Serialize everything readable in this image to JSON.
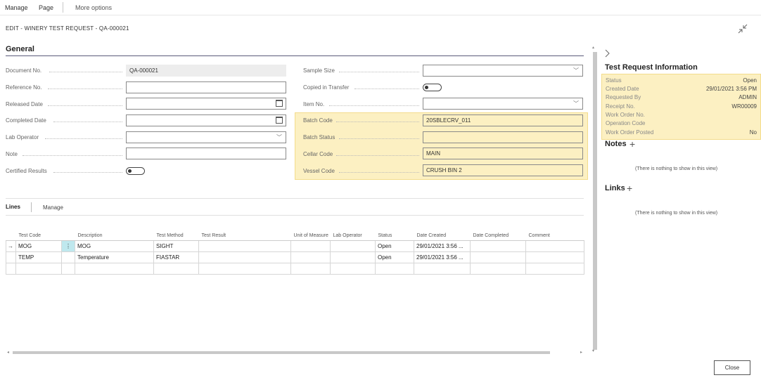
{
  "actionbar": {
    "manage": "Manage",
    "page": "Page",
    "more": "More options"
  },
  "page_title": "EDIT - WINERY TEST REQUEST - QA-000021",
  "general": {
    "heading": "General",
    "document_no_label": "Document No.",
    "document_no": "QA-000021",
    "reference_no_label": "Reference No.",
    "reference_no": "",
    "released_date_label": "Released Date",
    "released_date": "",
    "completed_date_label": "Completed Date",
    "completed_date": "",
    "lab_operator_label": "Lab Operator",
    "lab_operator": "",
    "note_label": "Note",
    "note": "",
    "certified_label": "Certified Results",
    "sample_size_label": "Sample Size",
    "sample_size": "",
    "copied_label": "Copied in Transfer",
    "item_no_label": "Item No.",
    "item_no": "",
    "batch_code_label": "Batch Code",
    "batch_code": "20SBLECRV_011",
    "batch_status_label": "Batch Status",
    "batch_status": "",
    "cellar_code_label": "Cellar Code",
    "cellar_code": "MAIN",
    "vessel_code_label": "Vessel Code",
    "vessel_code": "CRUSH BIN 2"
  },
  "lines": {
    "tab_lines": "Lines",
    "tab_manage": "Manage",
    "columns": [
      "Test Code",
      "Description",
      "Test Method",
      "Test Result",
      "Unit of Measure",
      "Lab Operator",
      "Status",
      "Date Created",
      "Date Completed",
      "Comment"
    ],
    "rows": [
      {
        "code": "MOG",
        "desc": "MOG",
        "method": "SIGHT",
        "result": "",
        "uom": "",
        "operator": "",
        "status": "Open",
        "created": "29/01/2021 3:56 ...",
        "completed": "",
        "comment": ""
      },
      {
        "code": "TEMP",
        "desc": "Temperature",
        "method": "FIASTAR",
        "result": "",
        "uom": "",
        "operator": "",
        "status": "Open",
        "created": "29/01/2021 3:56 ...",
        "completed": "",
        "comment": ""
      }
    ]
  },
  "factbox": {
    "title": "Test Request Information",
    "status_label": "Status",
    "status": "Open",
    "created_label": "Created Date",
    "created": "29/01/2021 3:56 PM",
    "requested_label": "Requested By",
    "requested": "ADMIN",
    "receipt_label": "Receipt No.",
    "receipt": "WR00009",
    "work_order_label": "Work Order No.",
    "work_order": "",
    "operation_label": "Operation Code",
    "operation": "",
    "posted_label": "Work Order Posted",
    "posted": "No",
    "notes_title": "Notes",
    "notes_empty": "(There is nothing to show in this view)",
    "links_title": "Links",
    "links_empty": "(There is nothing to show in this view)"
  },
  "close_label": "Close",
  "colors": {
    "highlight": "#fcf0c2",
    "accent": "#5a5a7a"
  }
}
